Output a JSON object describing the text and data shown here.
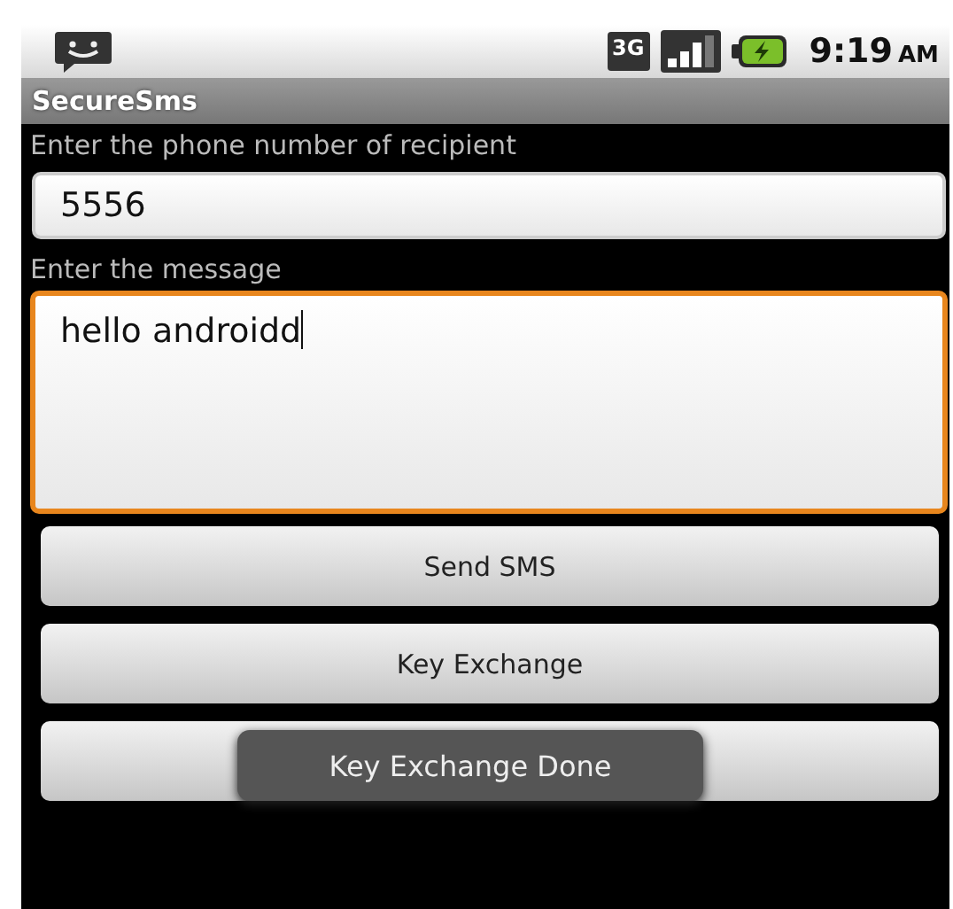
{
  "status_bar": {
    "network_type": "3G",
    "time": "9:19",
    "meridiem": "AM",
    "charging": true
  },
  "title_bar": {
    "title": "SecureSms"
  },
  "fields": [
    {
      "label": "Enter the phone number of recipient",
      "value": "5556",
      "focused": false,
      "kind": "single"
    },
    {
      "label": "Enter the message",
      "value": "hello androidd",
      "focused": true,
      "kind": "multi"
    }
  ],
  "buttons": [
    {
      "kind": "labeled",
      "label": "Send SMS"
    },
    {
      "kind": "labeled",
      "label": "Key Exchange"
    },
    {
      "kind": "covered"
    }
  ],
  "toast": {
    "text": "Key Exchange Done"
  }
}
